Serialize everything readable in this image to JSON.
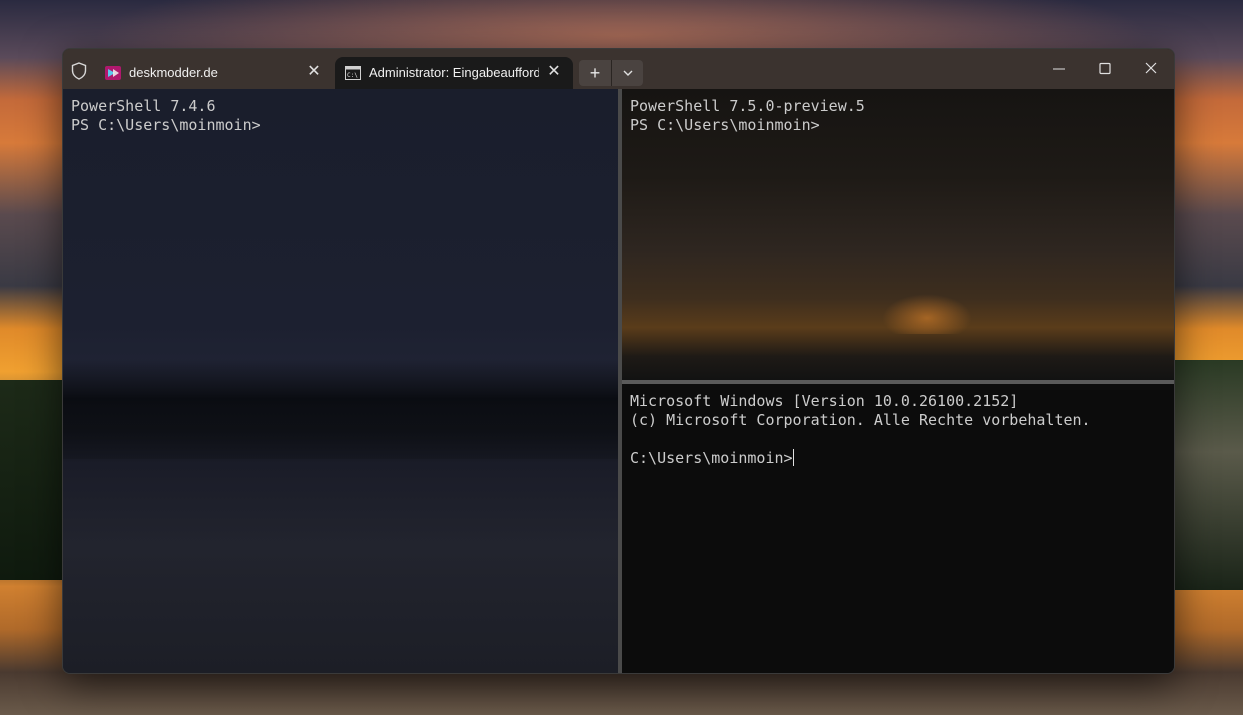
{
  "window": {
    "tabs": [
      {
        "title": "deskmodder.de",
        "active": false,
        "icon": "deskmodder-favicon"
      },
      {
        "title": "Administrator: Eingabeaufforderung",
        "active": true,
        "icon": "cmd-icon"
      }
    ],
    "new_tab_label": "+",
    "dropdown_label": "⌄",
    "minimize_label": "—",
    "maximize_label": "☐",
    "close_label": "✕"
  },
  "panes": {
    "left": {
      "lines": [
        "PowerShell 7.4.6",
        "PS C:\\Users\\moinmoin>"
      ]
    },
    "top_right": {
      "lines": [
        "PowerShell 7.5.0-preview.5",
        "PS C:\\Users\\moinmoin>"
      ]
    },
    "bottom_right": {
      "line1": "Microsoft Windows [Version 10.0.26100.2152]",
      "line2": "(c) Microsoft Corporation. Alle Rechte vorbehalten.",
      "prompt": "C:\\Users\\moinmoin>"
    }
  },
  "colors": {
    "terminal_text": "#cccccc",
    "titlebar_bg": "#3b332f",
    "active_tab_bg": "#1a1a1a"
  }
}
